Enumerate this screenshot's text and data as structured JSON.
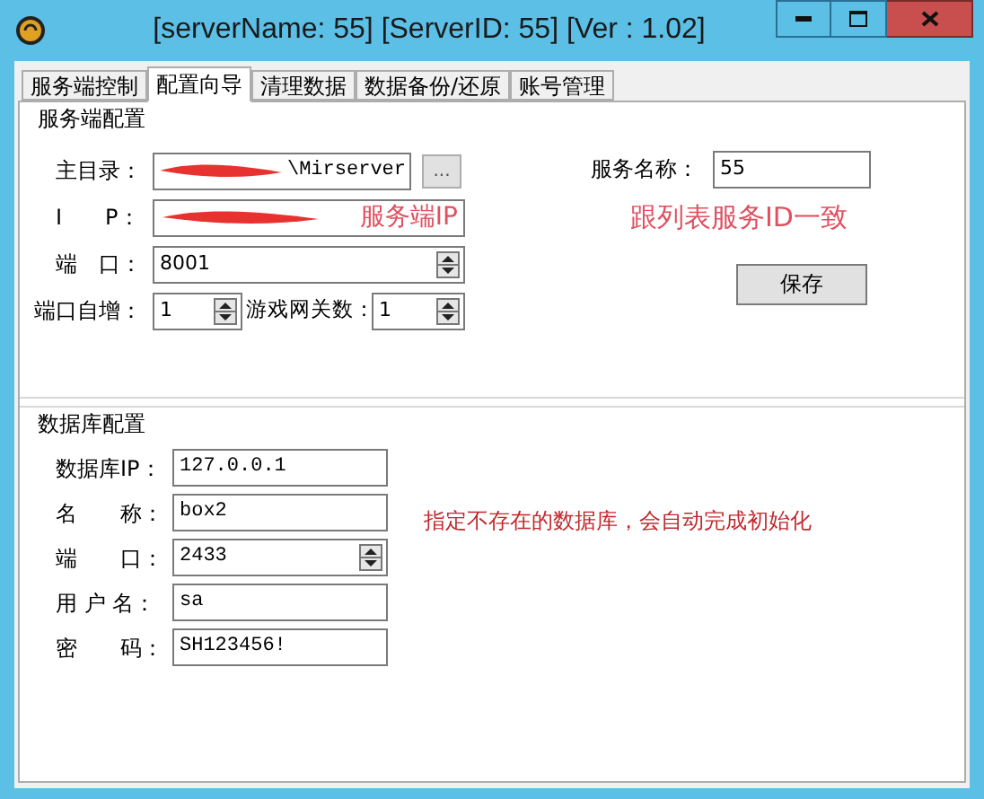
{
  "window": {
    "title": "[serverName: 55] [ServerID: 55] [Ver : 1.02]"
  },
  "tabs": [
    {
      "label": "服务端控制",
      "selected": false
    },
    {
      "label": "配置向导",
      "selected": true
    },
    {
      "label": "清理数据",
      "selected": false
    },
    {
      "label": "数据备份/还原",
      "selected": false
    },
    {
      "label": "账号管理",
      "selected": false
    }
  ],
  "server_group": {
    "title": "服务端配置",
    "main_dir": {
      "label": "主目录：",
      "value": "\\Mirserver",
      "browse": "...",
      "redacted": true
    },
    "ip": {
      "label": "I　　P：",
      "redacted": true,
      "note": "服务端IP"
    },
    "port": {
      "label": "端　口：",
      "value": "8001"
    },
    "port_increment": {
      "label": "端口自增：",
      "value": "1"
    },
    "gateway_count": {
      "label": "游戏网关数：",
      "value": "1"
    },
    "service_name": {
      "label": "服务名称：",
      "value": "55"
    },
    "note": "跟列表服务ID一致",
    "save_button": "保存"
  },
  "database_group": {
    "title": "数据库配置",
    "fields": [
      {
        "kind": "text",
        "label": "数据库IP：",
        "value": "127.0.0.1"
      },
      {
        "kind": "text",
        "label": "名　　称：",
        "value": "box2"
      },
      {
        "kind": "spin",
        "label": "端　　口：",
        "value": "2433"
      },
      {
        "kind": "text",
        "label": "用 户 名：",
        "value": "sa"
      },
      {
        "kind": "text",
        "label": "密　　码：",
        "value": "SH123456!"
      }
    ],
    "note": "指定不存在的数据库，会自动完成初始化"
  }
}
